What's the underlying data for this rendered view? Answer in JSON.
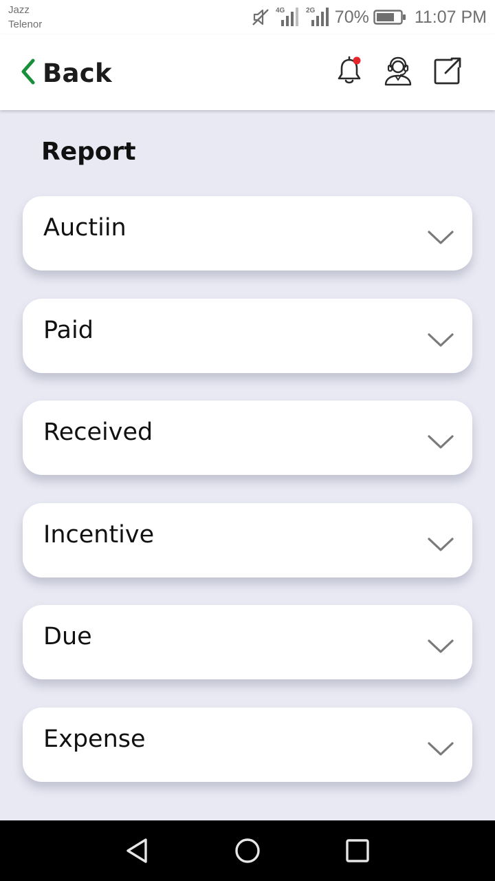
{
  "status_bar": {
    "carrier_1": "Jazz",
    "carrier_2": "Telenor",
    "network_1": "4G",
    "network_2": "2G",
    "battery": "70%",
    "time": "11:07 PM"
  },
  "app_bar": {
    "back_label": "Back",
    "accent_color": "#1a8f3a",
    "notification_dot_color": "#e3262b",
    "icons": [
      "chevron-left-icon",
      "bell-icon",
      "support-agent-icon",
      "external-link-icon"
    ]
  },
  "page": {
    "title": "Report"
  },
  "reports": [
    {
      "label": "Auctiin"
    },
    {
      "label": "Paid"
    },
    {
      "label": "Received"
    },
    {
      "label": "Incentive"
    },
    {
      "label": "Due"
    },
    {
      "label": "Expense"
    }
  ],
  "nav_bar": {
    "icons": [
      "back-triangle-icon",
      "home-circle-icon",
      "recents-square-icon"
    ]
  }
}
